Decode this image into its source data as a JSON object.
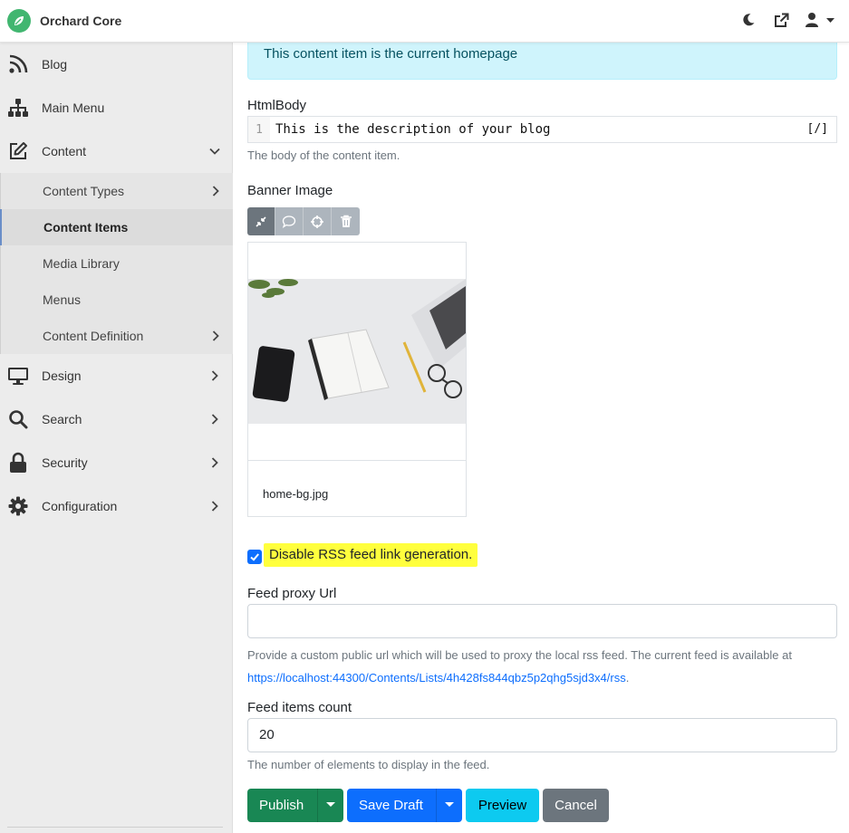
{
  "header": {
    "brand_name": "Orchard Core",
    "icons": [
      "leaf-icon",
      "moon-icon",
      "external-link-icon",
      "user-icon",
      "caret-down-icon"
    ]
  },
  "sidebar": {
    "items": [
      {
        "label": "Blog",
        "icon": "rss-icon"
      },
      {
        "label": "Main Menu",
        "icon": "sitemap-icon"
      },
      {
        "label": "Content",
        "icon": "edit-icon",
        "expanded": true
      },
      {
        "label": "Design",
        "icon": "monitor-icon"
      },
      {
        "label": "Search",
        "icon": "search-icon"
      },
      {
        "label": "Security",
        "icon": "lock-icon"
      },
      {
        "label": "Configuration",
        "icon": "gear-icon"
      }
    ],
    "content_sub": [
      {
        "label": "Content Types"
      },
      {
        "label": "Content Items",
        "active": true
      },
      {
        "label": "Media Library"
      },
      {
        "label": "Menus"
      },
      {
        "label": "Content Definition"
      }
    ]
  },
  "main": {
    "alert": "This content item is the current homepage",
    "htmlbody": {
      "label": "HtmlBody",
      "line_number": "1",
      "code": "This is the description of your blog",
      "toggle": "[/]",
      "hint": "The body of the content item."
    },
    "banner": {
      "label": "Banner Image",
      "file_name": "home-bg.jpg"
    },
    "rss": {
      "label": "Disable RSS feed link generation.",
      "checked": true
    },
    "feed_proxy": {
      "label": "Feed proxy Url",
      "value": "",
      "hint": "Provide a custom public url which will be used to proxy the local rss feed. The current feed is available at",
      "link": "https://localhost:44300/Contents/Lists/4h428fs844qbz5p2qhg5sjd3x4/rss",
      "link_suffix": "."
    },
    "feed_count": {
      "label": "Feed items count",
      "value": "20",
      "hint": "The number of elements to display in the feed."
    },
    "buttons": {
      "publish": "Publish",
      "save_draft": "Save Draft",
      "preview": "Preview",
      "cancel": "Cancel"
    }
  },
  "colors": {
    "brand": "#41b670",
    "alert_bg": "#cff4fc",
    "highlight": "#ffff3d",
    "publish": "#198754",
    "save_draft": "#0d6efd",
    "preview": "#0dcaf0",
    "cancel": "#6c757d"
  }
}
